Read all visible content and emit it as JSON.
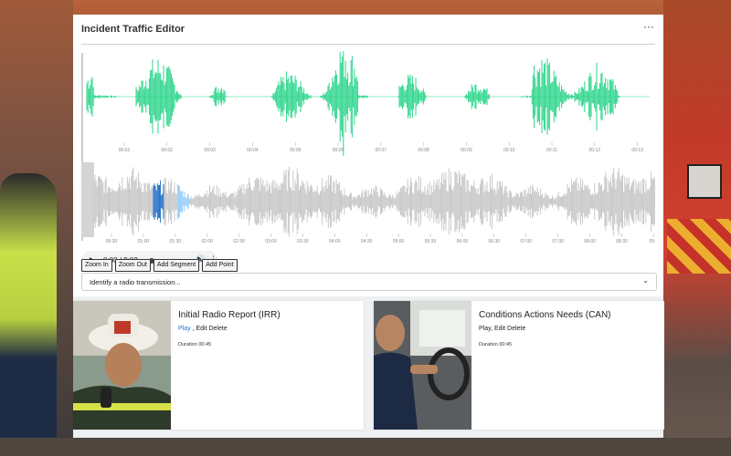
{
  "panel": {
    "title": "Incident Traffic Editor",
    "more_icon": "more-horizontal-icon"
  },
  "overview_ticks": [
    "00:01",
    "00:02",
    "00:03",
    "00:04",
    "00:05",
    "00:06",
    "00:07",
    "00:08",
    "00:09",
    "00:10",
    "00:11",
    "00:12",
    "00:13"
  ],
  "zoom_ticks": [
    "00:30",
    "01:00",
    "01:30",
    "02:00",
    "02:30",
    "03:00",
    "03:30",
    "04:00",
    "04:30",
    "05:00",
    "05:30",
    "06:00",
    "06:30",
    "07:00",
    "07:30",
    "08:00",
    "08:30",
    "09:0"
  ],
  "colors": {
    "overview_wave": "#2ed58c",
    "zoom_wave": "#c4c4c4",
    "segment_a": "#1565c0",
    "segment_b": "#90caf9",
    "link": "#1a73e8"
  },
  "player": {
    "play_icon": "play-icon",
    "time": "0:00 / 9:02",
    "progress": 0,
    "volume_icon": "volume-icon",
    "more_icon": "more-vertical-icon"
  },
  "buttons": {
    "zoom_in": "Zoom In",
    "zoom_out": "Zoom Out",
    "add_segment": "Add Segment",
    "add_point": "Add Point"
  },
  "select": {
    "value": "Identify a radio transmission...",
    "chevron_icon": "chevron-down-icon"
  },
  "cards": [
    {
      "title": "Initial Radio Report (IRR)",
      "play": "Play",
      "sep": " , ",
      "edit": "Edit",
      "delete": "Delete",
      "duration": "Duration 00:45"
    },
    {
      "title": "Conditions Actions Needs (CAN)",
      "play": "Play",
      "sep": ", ",
      "edit": "Edit",
      "delete": "Delete",
      "duration": "Duration 00:45"
    }
  ]
}
